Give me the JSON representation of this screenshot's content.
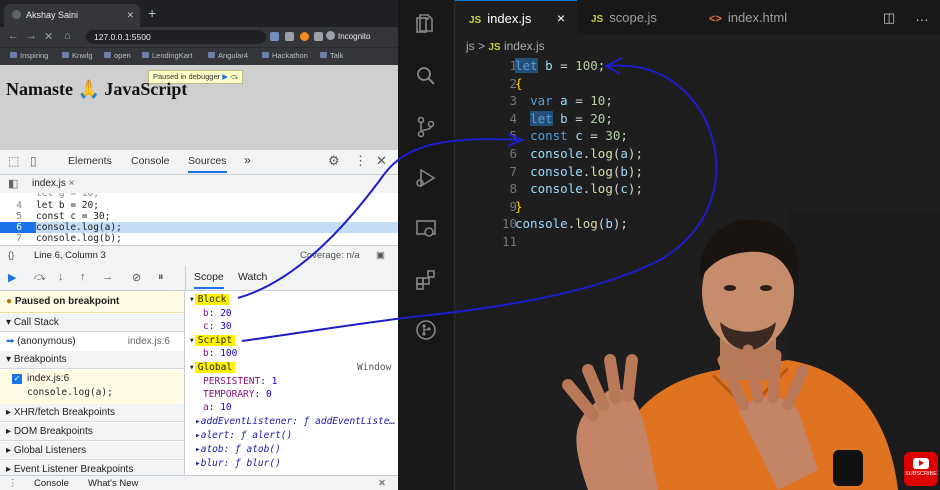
{
  "browser": {
    "tab_title": "Akshay Saini",
    "url": "127.0.0.1:5500",
    "incognito_label": "Incognito",
    "bookmarks": [
      "Inspiring",
      "Knwlg",
      "open",
      "LendingKart",
      "Angular4",
      "Hackathon",
      "Talk"
    ]
  },
  "page": {
    "title": "Namaste 🙏 JavaScript",
    "paused_label": "Paused in debugger"
  },
  "devtools": {
    "tabs": [
      "Elements",
      "Console",
      "Sources"
    ],
    "active_tab": "Sources",
    "more": "»",
    "file_tab": "index.js",
    "code_lines": [
      {
        "n": "4",
        "text": "let b = 20;"
      },
      {
        "n": "5",
        "text": "const c = 30;"
      },
      {
        "n": "6",
        "text": "console.log(a);"
      },
      {
        "n": "7",
        "text": "console.log(b);"
      }
    ],
    "position": "Line 6, Column 3",
    "coverage": "Coverage: n/a",
    "scope_tab": "Scope",
    "watch_tab": "Watch",
    "paused_on": "Paused on breakpoint",
    "call_stack_label": "Call Stack",
    "call_frame": "(anonymous)",
    "call_loc": "index.js:6",
    "breakpoints_label": "Breakpoints",
    "bp_file": "index.js:6",
    "bp_code": "console.log(a);",
    "xhr": "XHR/fetch Breakpoints",
    "dom": "DOM Breakpoints",
    "global_listeners": "Global Listeners",
    "event_listener": "Event Listener Breakpoints",
    "scope": {
      "block": "Block",
      "block_b_key": "b",
      "block_b_val": "20",
      "block_c_key": "c",
      "block_c_val": "30",
      "script": "Script",
      "script_b_key": "b",
      "script_b_val": "100",
      "global": "Global",
      "global_type": "Window",
      "persistent_key": "PERSISTENT",
      "persistent_val": "1",
      "temporary_key": "TEMPORARY",
      "temporary_val": "0",
      "a_key": "a",
      "a_val": "10",
      "ael": "addEventListener: ƒ addEventListe…",
      "alert": "alert: ƒ alert()",
      "atob": "atob: ƒ atob()",
      "blur": "blur: ƒ blur()"
    },
    "console_tab": "Console",
    "whats_new": "What's New"
  },
  "editor": {
    "tabs": [
      {
        "badge": "JS",
        "label": "index.js",
        "close": "×"
      },
      {
        "badge": "JS",
        "label": "scope.js"
      },
      {
        "badge": "<>",
        "label": "index.html"
      }
    ],
    "breadcrumb_folder": "js",
    "breadcrumb_sep": ">",
    "breadcrumb_badge": "JS",
    "breadcrumb_file": "index.js",
    "lines": [
      "1",
      "2",
      "3",
      "4",
      "5",
      "6",
      "7",
      "8",
      "9",
      "10",
      "11"
    ]
  },
  "overlay": {
    "youtube_label": "SUBSCRIBE"
  },
  "colors": {
    "vscode_bg": "#1e1e1e",
    "highlight": "#fff200",
    "annotation": "#1d1dc9",
    "shirt": "#e0731f"
  }
}
